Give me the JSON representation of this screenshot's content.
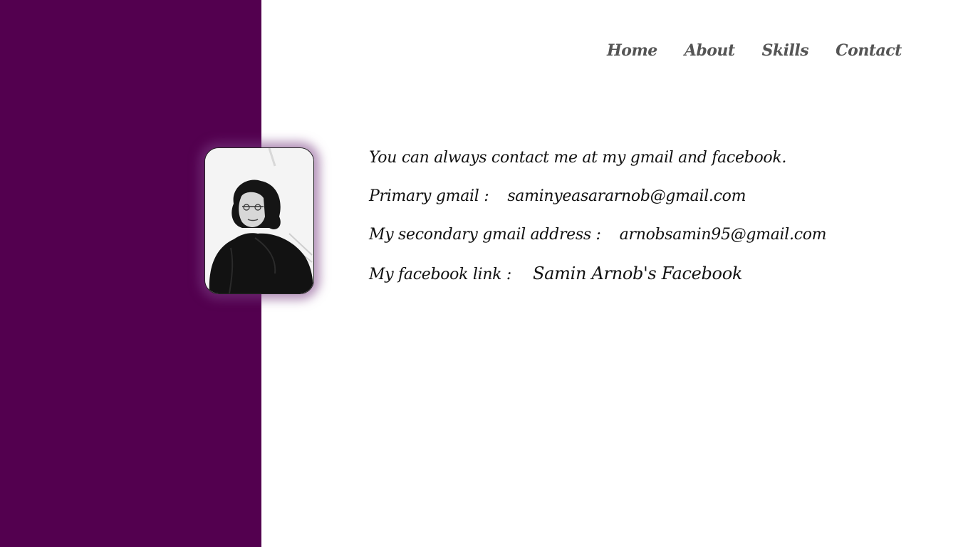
{
  "nav": {
    "home": "Home",
    "about": "About",
    "skills": "Skills",
    "contact": "Contact"
  },
  "profile": {
    "photo_icon": "person-portrait"
  },
  "contact": {
    "intro": "You can always contact me at my gmail and facebook.",
    "primary_label": "Primary gmail :",
    "primary_value": "saminyeasararnob@gmail.com",
    "secondary_label": "My secondary gmail address :",
    "secondary_value": "arnobsamin95@gmail.com",
    "facebook_label": "My facebook link :",
    "facebook_link_text": "Samin Arnob's Facebook"
  },
  "colors": {
    "panel": "#53004f",
    "nav_text": "#555555",
    "body_text": "#111111",
    "photo_glow": "#7a3c82"
  }
}
